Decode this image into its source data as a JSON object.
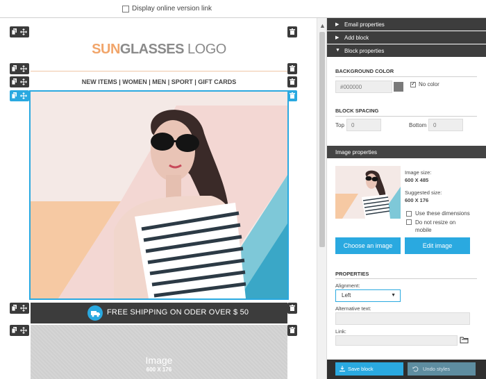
{
  "topbar": {
    "display_online_label": "Display online version link"
  },
  "email": {
    "logo": {
      "part1": "SUN",
      "part2": "GLASSES",
      "part3": " LOGO"
    },
    "nav_text": "NEW ITEMS | WOMEN | MEN | SPORT | GIFT CARDS",
    "shipping_text": "FREE SHIPPING ON ODER OVER $ 50",
    "placeholder": {
      "title": "Image",
      "size": "600 X 176"
    }
  },
  "panel": {
    "accordion": {
      "email_properties": "Email properties",
      "add_block": "Add block",
      "block_properties": "Block properties"
    },
    "background_color": {
      "title": "BACKGROUND COLOR",
      "placeholder": "#000000",
      "no_color_label": "No color",
      "swatch_color": "#7a7a7a"
    },
    "block_spacing": {
      "title": "BLOCK SPACING",
      "top_label": "Top",
      "top_value": "0",
      "bottom_label": "Bottom",
      "bottom_value": "0"
    },
    "image_properties": {
      "title": "Image properties",
      "image_size_label": "Image size:",
      "image_size_value": "600 X 485",
      "suggested_label": "Suggested size:",
      "suggested_value": "600 X 176",
      "use_dimensions": "Use these dimensions",
      "do_not_resize": "Do not resize on mobile",
      "choose_button": "Choose an image",
      "edit_button": "Edit image"
    },
    "properties": {
      "title": "PROPERTIES",
      "alignment_label": "Alignment:",
      "alignment_value": "Left",
      "alt_label": "Alternative text:",
      "link_label": "Link:"
    },
    "footer": {
      "save_label": "Save block",
      "undo_label": "Undo styles"
    }
  },
  "colors": {
    "accent": "#2aa9e0",
    "dark": "#3d3d3d",
    "logo_orange": "#f1a56a"
  }
}
